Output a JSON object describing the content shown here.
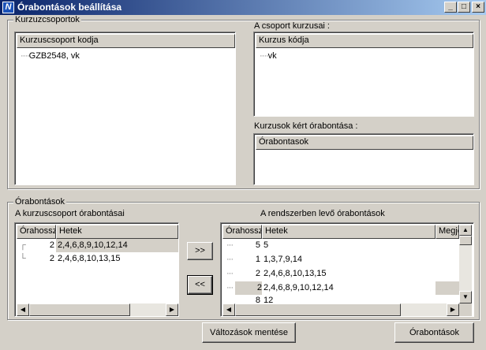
{
  "window": {
    "title": "Órabontások beállítása",
    "icon_letter": "N",
    "controls": [
      "_",
      "□",
      "×"
    ]
  },
  "kurzuscsoportok": {
    "group_label": "Kurzuzcsoportok",
    "column_header": "Kurzuscsoport kodja",
    "items": [
      "GZB2548, vk"
    ]
  },
  "csoport_kurzusai": {
    "label": "A csoport kurzusai :",
    "column_header": "Kurzus kódja",
    "items": [
      "vk"
    ]
  },
  "kert_orabontasa": {
    "label": "Kurzusok kért órabontása :",
    "column_header": "Órabontasok"
  },
  "orabontasok": {
    "group_label": "Órabontások",
    "left": {
      "label": "A kurzuscsoport órabontásai",
      "columns": [
        "Órahossz",
        "Hetek"
      ],
      "rows": [
        {
          "hours": "2",
          "weeks": "2,4,6,8,9,10,12,14"
        },
        {
          "hours": "2",
          "weeks": "2,4,6,8,10,13,15"
        }
      ]
    },
    "right": {
      "label": "A rendszerben levő órabontások",
      "columns": [
        "Órahossz",
        "Hetek",
        "Megje"
      ],
      "rows": [
        {
          "hours": "5",
          "weeks": "5"
        },
        {
          "hours": "1",
          "weeks": "1,3,7,9,14"
        },
        {
          "hours": "2",
          "weeks": "2,4,6,8,10,13,15"
        },
        {
          "hours": "2",
          "weeks": "2,4,6,8,9,10,12,14"
        },
        {
          "hours": "8",
          "weeks": "12"
        }
      ]
    },
    "add_button": ">>",
    "remove_button": "<<"
  },
  "footer": {
    "save_button": "Változások mentése",
    "orabontasok_button": "Órabontások"
  }
}
